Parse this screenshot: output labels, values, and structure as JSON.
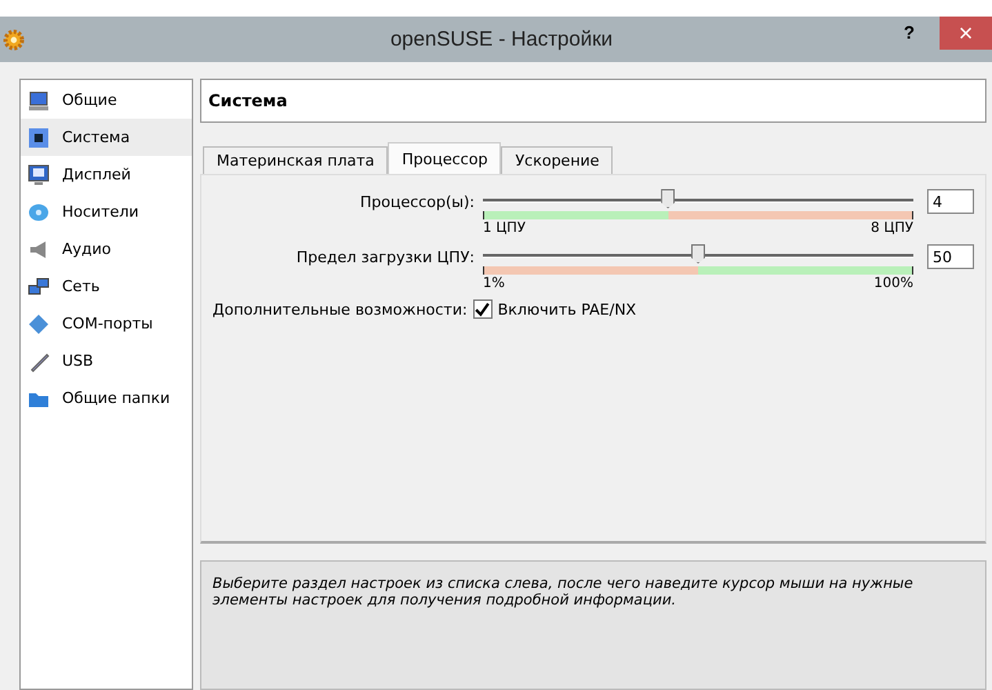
{
  "window": {
    "title": "openSUSE - Настройки",
    "help": "?",
    "close": "×"
  },
  "sidebar": {
    "items": [
      {
        "label": "Общие",
        "selected": false
      },
      {
        "label": "Система",
        "selected": true
      },
      {
        "label": "Дисплей",
        "selected": false
      },
      {
        "label": "Носители",
        "selected": false
      },
      {
        "label": "Аудио",
        "selected": false
      },
      {
        "label": "Сеть",
        "selected": false
      },
      {
        "label": "COM-порты",
        "selected": false
      },
      {
        "label": "USB",
        "selected": false
      },
      {
        "label": "Общие папки",
        "selected": false
      }
    ]
  },
  "section_title": "Система",
  "tabs": [
    {
      "label": "Материнская плата",
      "selected": false
    },
    {
      "label": "Процессор",
      "selected": true
    },
    {
      "label": "Ускорение",
      "selected": false
    }
  ],
  "sliders": [
    {
      "label": "Процессор(ы):",
      "level": 0.43,
      "kind": "count",
      "min_label": "1 ЦПУ",
      "max_label": "8 ЦПУ",
      "value": "4"
    },
    {
      "label": "Предел загрузки ЦПУ:",
      "level": 0.5,
      "kind": "limit",
      "min_label": "1%",
      "max_label": "100%",
      "value": "50"
    }
  ],
  "extended": {
    "label": "Дополнительные возможности:",
    "checkbox": "Включить PAE/NX",
    "checked": true
  },
  "description": "Выберите раздел настроек из списка слева, после чего наведите курсор мыши на нужные элементы настроек для получения подробной информации."
}
